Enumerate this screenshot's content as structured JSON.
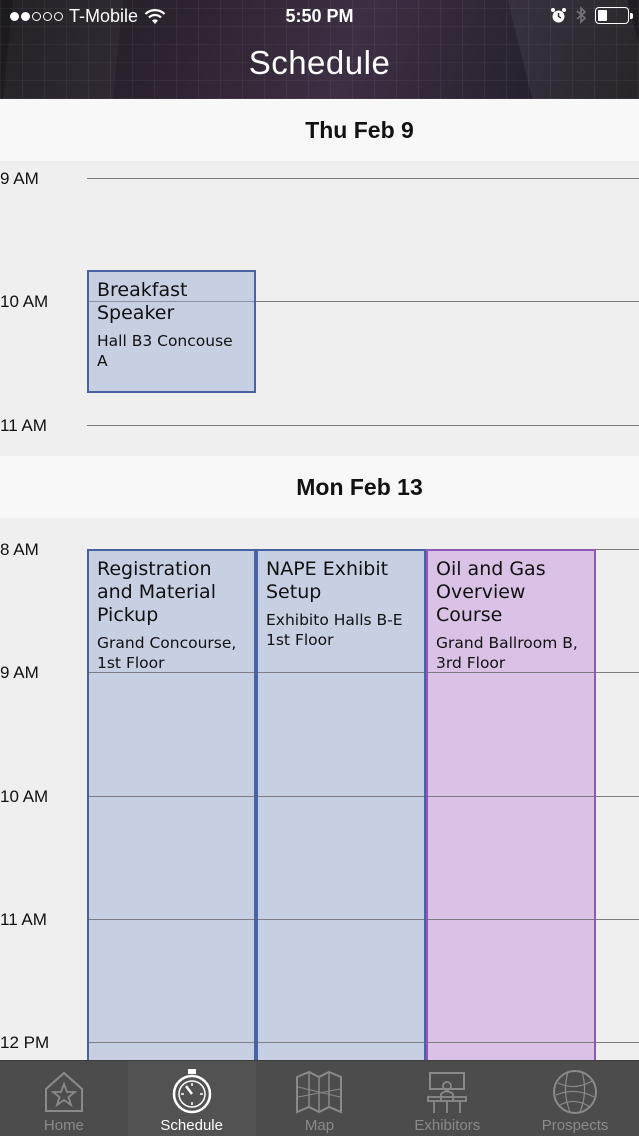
{
  "status_bar": {
    "carrier": "T-Mobile",
    "time": "5:50 PM",
    "battery_level": 0.3
  },
  "header": {
    "title": "Schedule"
  },
  "days": [
    {
      "label": "Thu Feb 9",
      "times": [
        "9 AM",
        "10 AM",
        "11 AM"
      ],
      "events": [
        {
          "title": "Breakfast Speaker",
          "location": "Hall B3 Concouse A",
          "color": "blue"
        }
      ]
    },
    {
      "label": "Mon Feb 13",
      "times": [
        "8 AM",
        "9 AM",
        "10 AM",
        "11 AM",
        "12 PM"
      ],
      "events": [
        {
          "title": "Registration and Material Pickup",
          "location": "Grand Concourse, 1st Floor",
          "color": "blue"
        },
        {
          "title": "NAPE Exhibit Setup",
          "location": "Exhibito Halls B-E 1st Floor",
          "color": "blue"
        },
        {
          "title": "Oil and Gas Overview Course",
          "location": "Grand Ballroom B, 3rd Floor",
          "color": "purple"
        }
      ]
    }
  ],
  "tabs": [
    {
      "label": "Home",
      "icon": "home-star-icon",
      "active": false
    },
    {
      "label": "Schedule",
      "icon": "stopwatch-icon",
      "active": true
    },
    {
      "label": "Map",
      "icon": "folded-map-icon",
      "active": false
    },
    {
      "label": "Exhibitors",
      "icon": "exhibitor-booth-icon",
      "active": false
    },
    {
      "label": "Prospects",
      "icon": "globe-icon",
      "active": false
    }
  ],
  "colors": {
    "event_blue_border": "#4862a2",
    "event_purple_border": "#8e57b9",
    "tabbar_bg": "#4c4c4d"
  }
}
